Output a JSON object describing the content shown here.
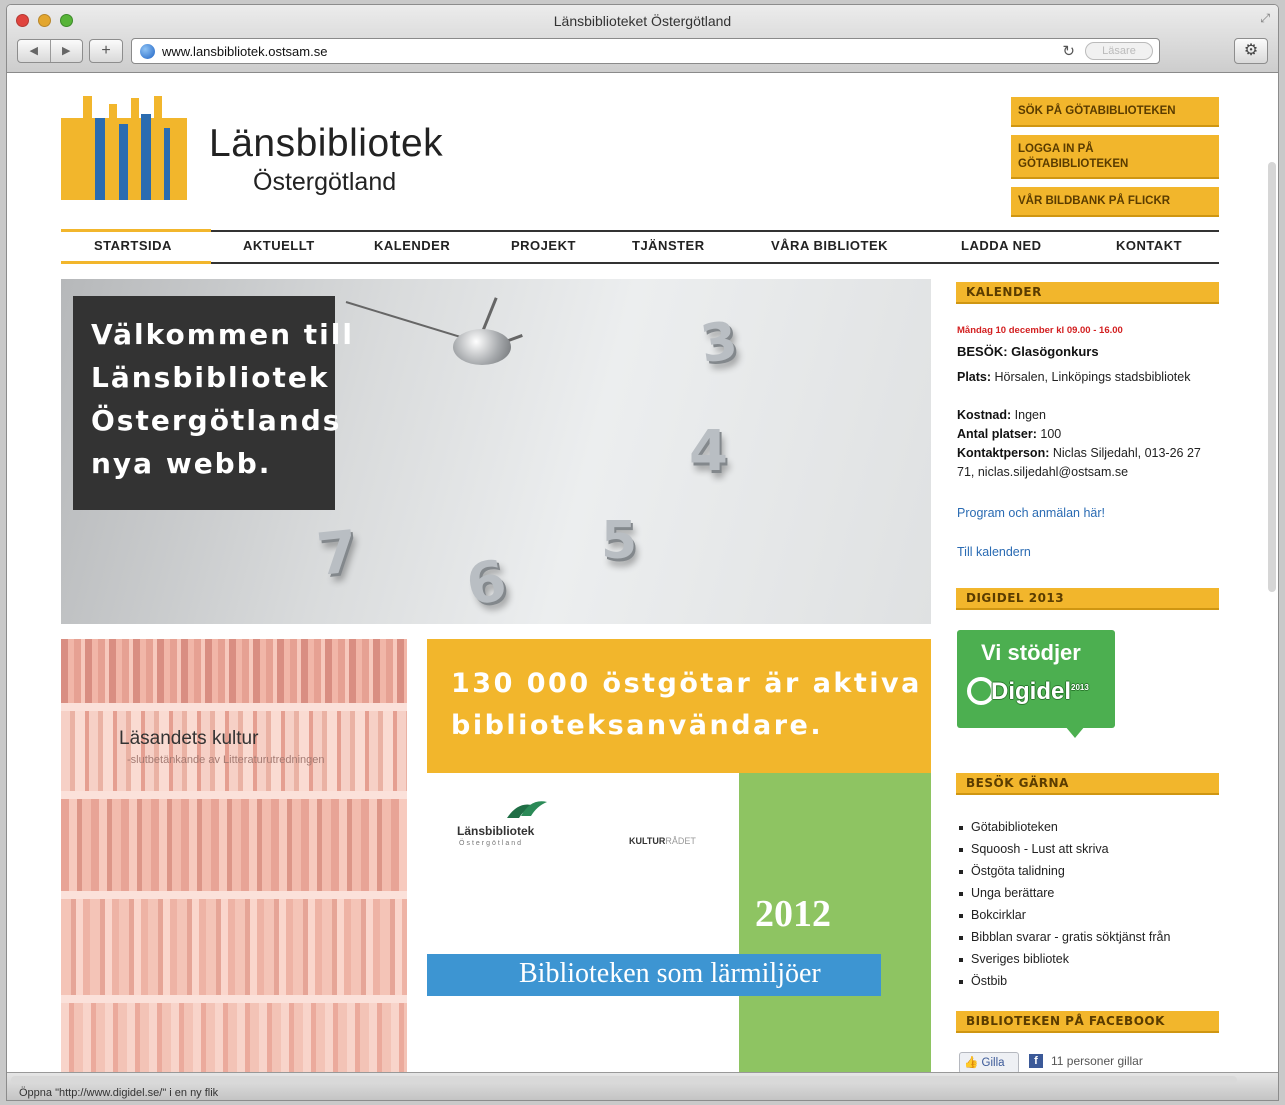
{
  "window": {
    "title": "Länsbiblioteket Östergötland",
    "url": "www.lansbibliotek.ostsam.se",
    "url_field_placeholder": "Läsare",
    "status_text": "Öppna \"http://www.digidel.se/\" i en ny flik"
  },
  "logo": {
    "title": "Länsbibliotek",
    "subtitle": "Östergötland"
  },
  "header_buttons": [
    {
      "label": "SÖK PÅ GÖTABIBLIOTEKEN"
    },
    {
      "label_line1": "LOGGA IN PÅ",
      "label_line2": "GÖTABIBLIOTEKEN"
    },
    {
      "label": "VÅR BILDBANK PÅ FLICKR"
    }
  ],
  "nav": [
    {
      "label": "STARTSIDA",
      "active": true
    },
    {
      "label": "AKTUELLT"
    },
    {
      "label": "KALENDER"
    },
    {
      "label": "PROJEKT"
    },
    {
      "label": "TJÄNSTER"
    },
    {
      "label": "VÅRA BIBLIOTEK"
    },
    {
      "label": "LADDA NED"
    },
    {
      "label": "KONTAKT"
    }
  ],
  "hero": {
    "lines": [
      "Välkommen till",
      "Länsbibliotek",
      "Östergötlands",
      "nya webb."
    ],
    "clock_numbers": [
      "3",
      "4",
      "5",
      "6",
      "7"
    ]
  },
  "books_banner": {
    "title": "Läsandets kultur",
    "subtitle": "-slutbetänkande av Litteraturutredningen"
  },
  "promo": {
    "line1": "130 000 östgötar är aktiva",
    "line2": "biblioteksanvändare.",
    "logo1_name": "Länsbibliotek",
    "logo1_sub": "Östergötland",
    "logo2_bold": "KULTUR",
    "logo2_light": "RÅDET",
    "year": "2012",
    "banner": "Biblioteken som lärmiljöer"
  },
  "calendar": {
    "heading": "KALENDER",
    "date": "Måndag 10 december kl 09.00 - 16.00",
    "event_title": "BESÖK: Glasögonkurs",
    "place_label": "Plats:",
    "place": "Hörsalen, Linköpings stadsbibliotek",
    "cost_label": "Kostnad:",
    "cost": "Ingen",
    "seats_label": "Antal platser:",
    "seats": "100",
    "contact_label": "Kontaktperson:",
    "contact": "Niclas Siljedahl, 013-26 27 71, niclas.siljedahl@ostsam.se",
    "link_program": "Program och anmälan här!",
    "link_calendar": "Till kalendern"
  },
  "digidel": {
    "heading": "DIGIDEL 2013",
    "tagline": "Vi stödjer",
    "logo_text": "Digidel",
    "logo_year": "2013"
  },
  "visit": {
    "heading": "BESÖK GÄRNA",
    "items": [
      "Götabiblioteken",
      "Squoosh - Lust att skriva",
      "Östgöta talidning",
      "Unga berättare",
      "Bokcirklar",
      "Bibblan svarar - gratis söktjänst från",
      "Sveriges bibliotek",
      "Östbib"
    ]
  },
  "facebook": {
    "heading": "BIBLIOTEKEN PÅ FACEBOOK",
    "like_button": "Gilla",
    "likes_text": "11 personer gillar"
  },
  "colors": {
    "accent": "#f2b62c",
    "link": "#2a6bb3",
    "date_red": "#d32021",
    "green": "#4caf50",
    "blue": "#3d95d2"
  }
}
